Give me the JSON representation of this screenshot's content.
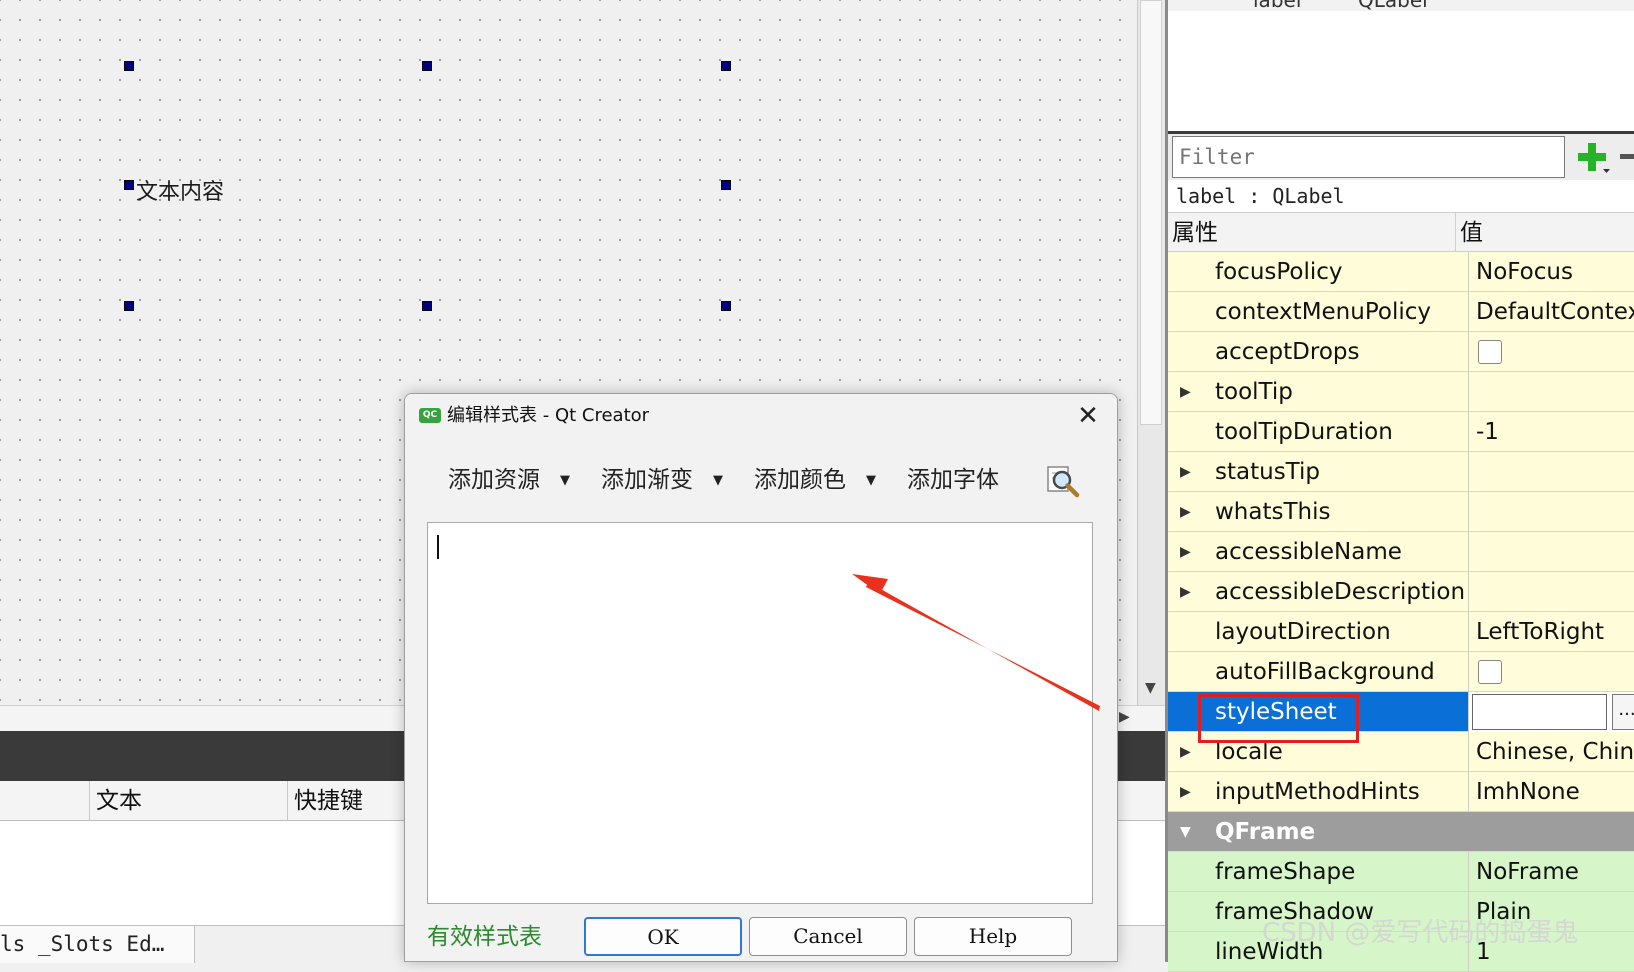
{
  "canvas": {
    "label_text": "文本内容"
  },
  "action_editor": {
    "columns": [
      "文本",
      "快捷键"
    ],
    "tab_label": "ls _Slots Ed…"
  },
  "object_inspector": {
    "header_cols": [
      "label",
      "QLabel"
    ]
  },
  "property_editor": {
    "filter_placeholder": "Filter",
    "object_class": "label : QLabel",
    "col_property": "属性",
    "col_value": "值",
    "rows": [
      {
        "name": "focusPolicy",
        "value": "NoFocus",
        "kind": "yellow"
      },
      {
        "name": "contextMenuPolicy",
        "value": "DefaultContext",
        "kind": "yellow"
      },
      {
        "name": "acceptDrops",
        "value": "",
        "kind": "yellow",
        "checkbox": true
      },
      {
        "name": "toolTip",
        "value": "",
        "kind": "yellow",
        "expand": true
      },
      {
        "name": "toolTipDuration",
        "value": "-1",
        "kind": "yellow"
      },
      {
        "name": "statusTip",
        "value": "",
        "kind": "yellow",
        "expand": true
      },
      {
        "name": "whatsThis",
        "value": "",
        "kind": "yellow",
        "expand": true
      },
      {
        "name": "accessibleName",
        "value": "",
        "kind": "yellow",
        "expand": true
      },
      {
        "name": "accessibleDescription",
        "value": "",
        "kind": "yellow",
        "expand": true
      },
      {
        "name": "layoutDirection",
        "value": "LeftToRight",
        "kind": "yellow"
      },
      {
        "name": "autoFillBackground",
        "value": "",
        "kind": "yellow",
        "checkbox": true
      },
      {
        "name": "styleSheet",
        "value": "",
        "kind": "selected",
        "more_label": "..."
      },
      {
        "name": "locale",
        "value": "Chinese, China",
        "kind": "yellow",
        "expand": true
      },
      {
        "name": "inputMethodHints",
        "value": "ImhNone",
        "kind": "yellow",
        "expand": true
      },
      {
        "name": "QFrame",
        "value": "",
        "kind": "group"
      },
      {
        "name": "frameShape",
        "value": "NoFrame",
        "kind": "green"
      },
      {
        "name": "frameShadow",
        "value": "Plain",
        "kind": "green"
      },
      {
        "name": "lineWidth",
        "value": "1",
        "kind": "green"
      }
    ]
  },
  "dialog": {
    "title": "编辑样式表 - Qt Creator",
    "app_icon_text": "QC",
    "toolbar": [
      "添加资源",
      "添加渐变",
      "添加颜色",
      "添加字体"
    ],
    "valid_label": "有效样式表",
    "ok_label": "OK",
    "cancel_label": "Cancel",
    "help_label": "Help",
    "close_glyph": "✕"
  },
  "watermark": "CSDN @爱写代码的捣蛋鬼",
  "colors": {
    "selection": "#0a6fd6",
    "annotation_red": "#e02020",
    "valid_green": "#2d8b2d"
  }
}
